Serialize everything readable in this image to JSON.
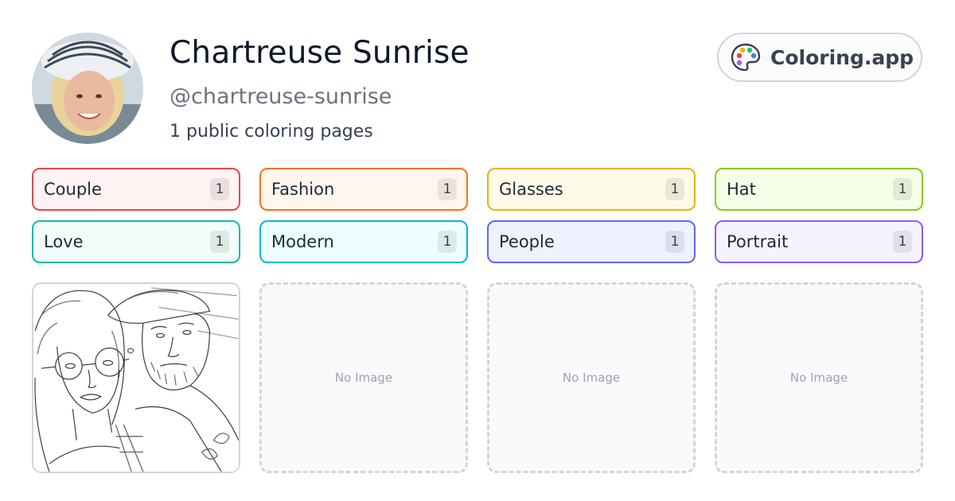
{
  "profile": {
    "name": "Chartreuse Sunrise",
    "handle": "@chartreuse-sunrise",
    "count_text": "1 public coloring pages"
  },
  "brand": {
    "name": "Coloring.app",
    "icon": "palette-icon"
  },
  "tags": [
    {
      "label": "Couple",
      "count": "1",
      "border": "#e5484d",
      "bg": "#fef2f2"
    },
    {
      "label": "Fashion",
      "count": "1",
      "border": "#f97316",
      "bg": "#fff7ed"
    },
    {
      "label": "Glasses",
      "count": "1",
      "border": "#eab308",
      "bg": "#fefce8"
    },
    {
      "label": "Hat",
      "count": "1",
      "border": "#84cc16",
      "bg": "#f7fee7"
    },
    {
      "label": "Love",
      "count": "1",
      "border": "#14b8a6",
      "bg": "#f0fdfa"
    },
    {
      "label": "Modern",
      "count": "1",
      "border": "#06b6d4",
      "bg": "#ecfeff"
    },
    {
      "label": "People",
      "count": "1",
      "border": "#6366f1",
      "bg": "#eef2ff"
    },
    {
      "label": "Portrait",
      "count": "1",
      "border": "#8b5cf6",
      "bg": "#f5f3ff"
    }
  ],
  "thumbnails": [
    {
      "type": "image",
      "subject": "couple-line-art"
    },
    {
      "type": "empty",
      "label": "No Image"
    },
    {
      "type": "empty",
      "label": "No Image"
    },
    {
      "type": "empty",
      "label": "No Image"
    }
  ]
}
